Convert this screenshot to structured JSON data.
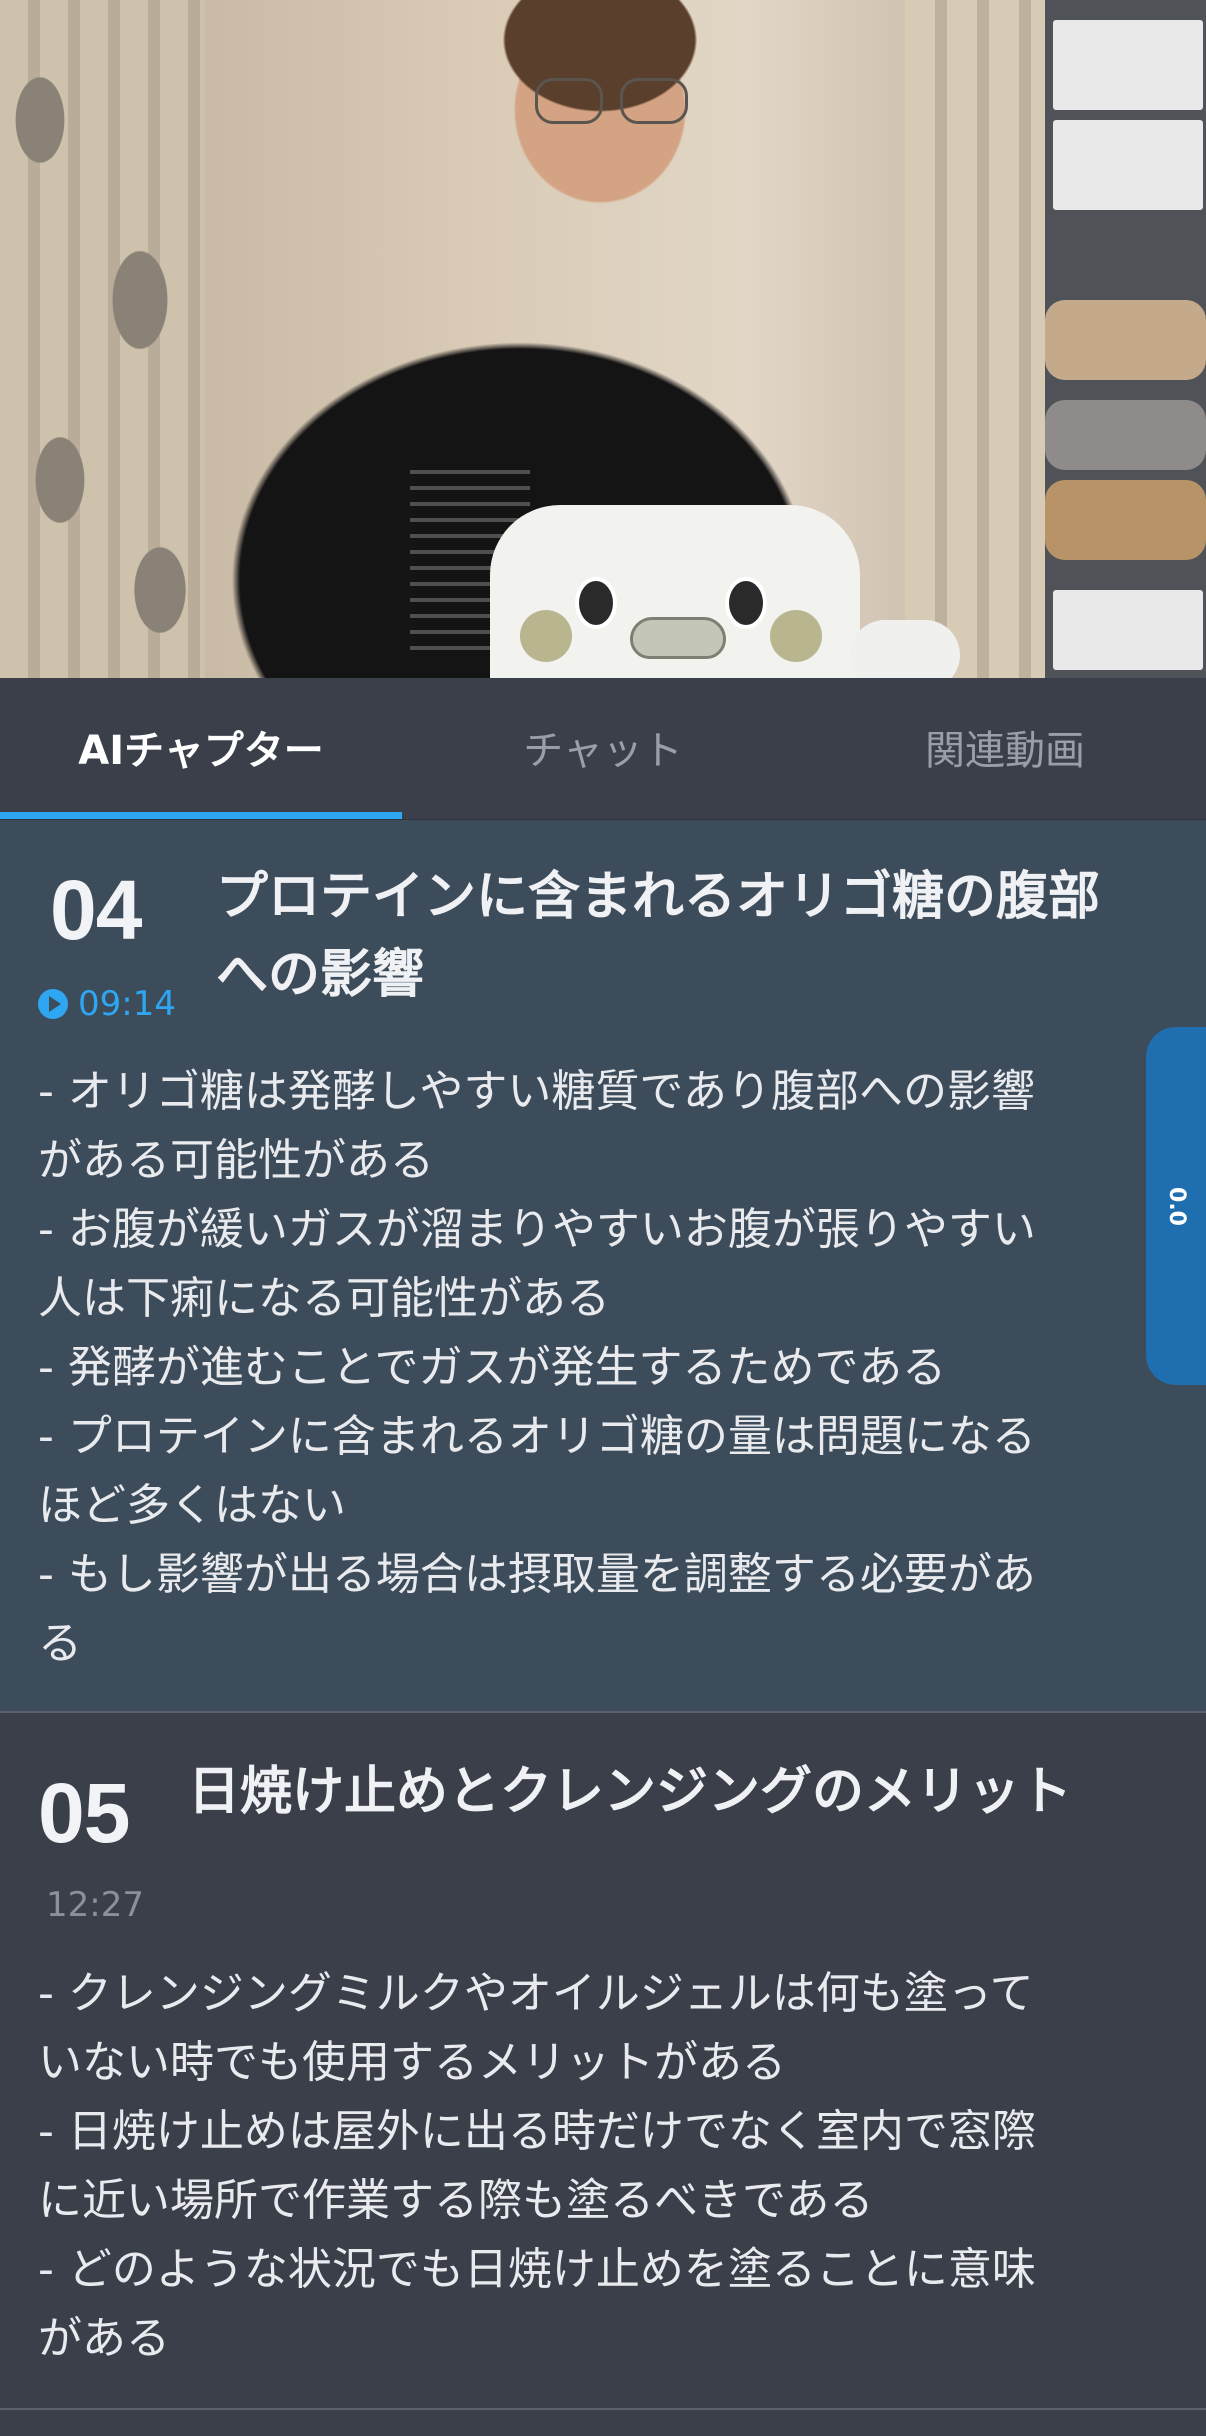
{
  "tabs": [
    {
      "label": "AIチャプター",
      "active": true
    },
    {
      "label": "チャット",
      "active": false
    },
    {
      "label": "関連動画",
      "active": false
    }
  ],
  "chapters": [
    {
      "number": "04",
      "title_line1": "プロテインに含まれるオリゴ糖の腹部",
      "title_line2": "への影響",
      "time": "09:14",
      "lines": [
        "- オリゴ糖は発酵しやすい糖質であり腹部への影響",
        "がある可能性がある",
        "- お腹が緩いガスが溜まりやすいお腹が張りやすい",
        "人は下痢になる可能性がある",
        "- 発酵が進むことでガスが発生するためである",
        "- プロテインに含まれるオリゴ糖の量は問題になる",
        "ほど多くはない",
        "- もし影響が出る場合は摂取量を調整する必要があ",
        "る"
      ]
    },
    {
      "number": "05",
      "title": "日焼け止めとクレンジングのメリット",
      "time": "12:27",
      "lines": [
        "- クレンジングミルクやオイルジェルは何も塗って",
        "いない時でも使用するメリットがある",
        "- 日焼け止めは屋外に出る時だけでなく室内で窓際",
        "に近い場所で作業する際も塗るべきである",
        "- どのような状況でも日焼け止めを塗ることに意味",
        "がある"
      ]
    }
  ],
  "side_handle": {
    "label": "0.0"
  },
  "colors": {
    "accent": "#2ea6f1",
    "active_bg": "#3d4c5a",
    "bg": "#3a3f4a"
  }
}
